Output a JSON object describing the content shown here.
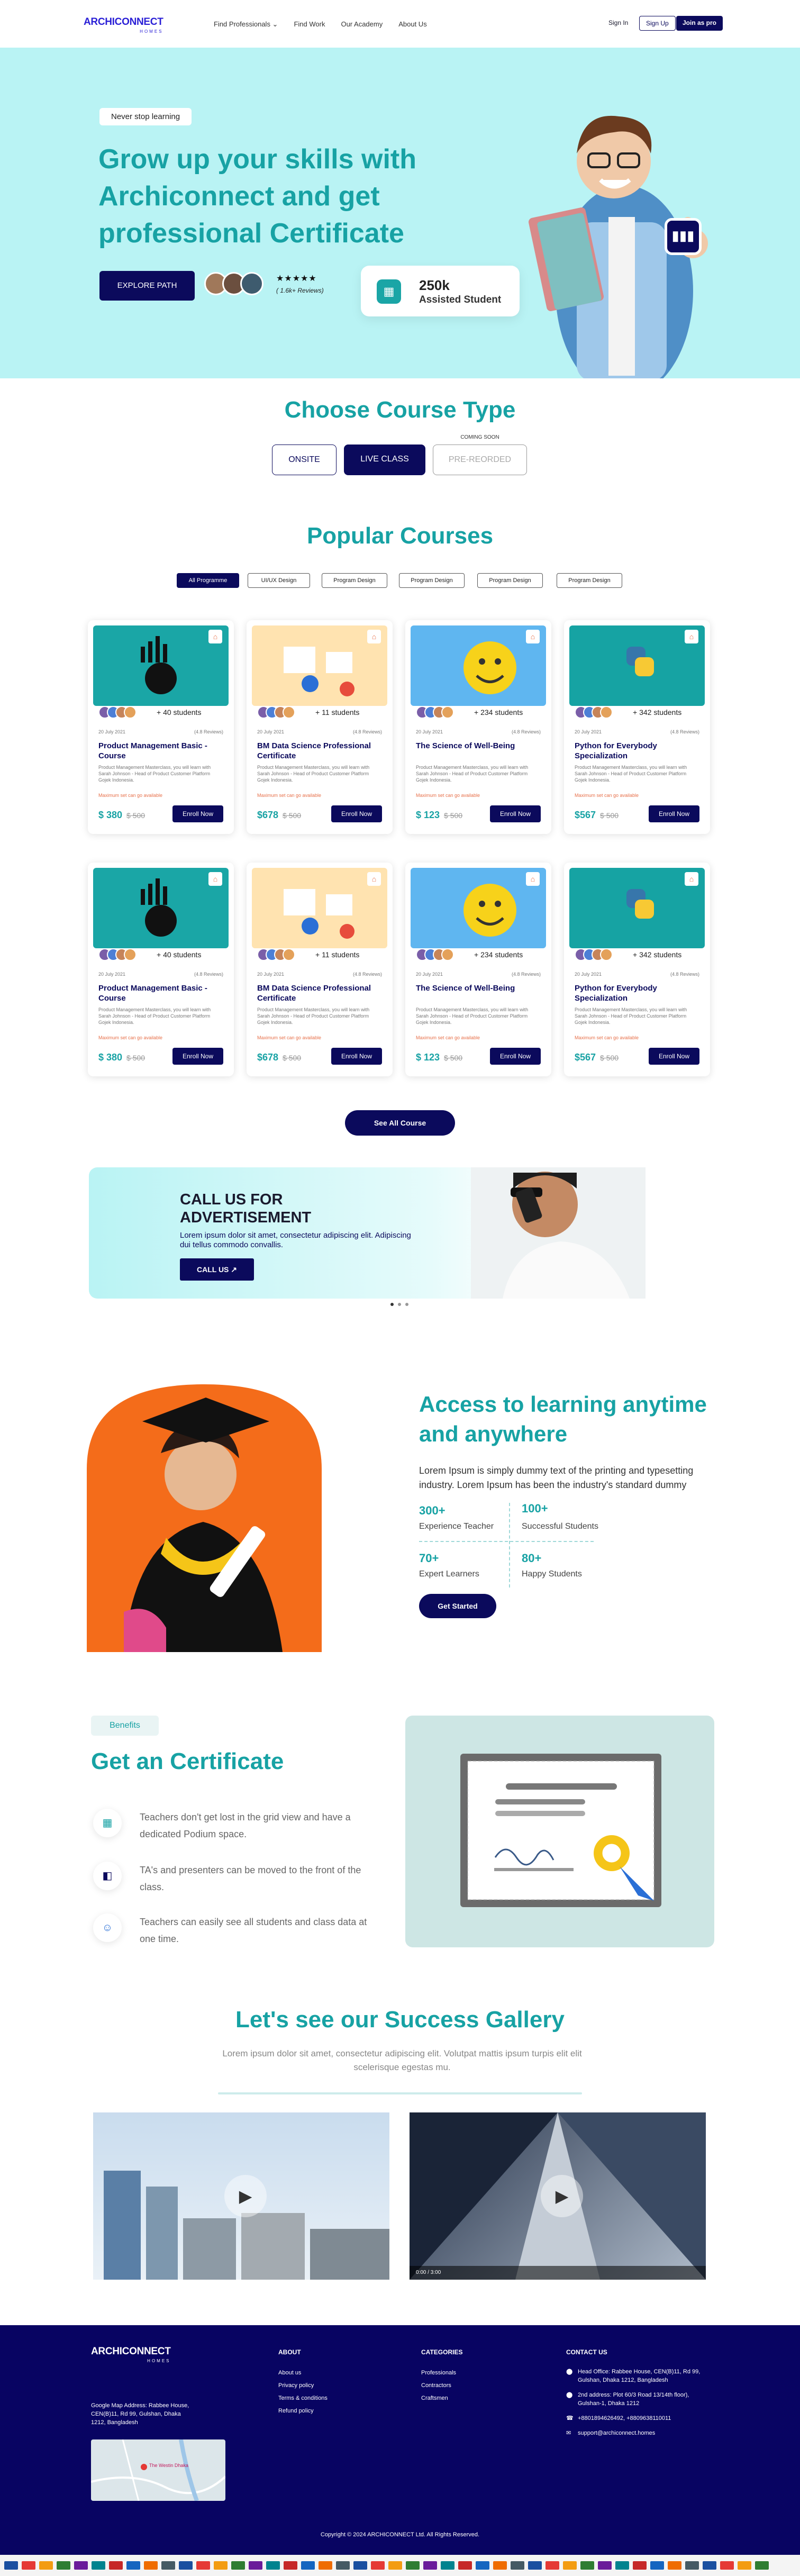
{
  "header": {
    "logo_main": "ARCHICONNECT",
    "logo_sub": "HOMES",
    "nav": [
      "Find Professionals ⌄",
      "Find Work",
      "Our Academy",
      "About Us"
    ],
    "signin": "Sign In",
    "signup": "Sign Up",
    "joinpro": "Join as pro"
  },
  "hero": {
    "pill": "Never stop learning",
    "title": "Grow up your skills with Archiconnect and get professional Certificate",
    "cta": "EXPLORE PATH",
    "stars": "★★★★★",
    "reviews": "( 1.6k+ Reviews)",
    "stat_value": "250k",
    "stat_label": "Assisted Student"
  },
  "course_type": {
    "title": "Choose Course Type",
    "onsite": "ONSITE",
    "live": "LIVE CLASS",
    "coming_soon": "COMING SOON",
    "prerecorded": "PRE-REORDED"
  },
  "popular": {
    "title": "Popular Courses",
    "tabs": [
      "All Programme",
      "UI/UX Design",
      "Program Design",
      "Program Design",
      "Program Design",
      "Program Design"
    ]
  },
  "cards": [
    {
      "students": "+ 40 students",
      "date": "20 July 2021",
      "reviews": "(4.8 Reviews)",
      "title": "Product Management Basic - Course",
      "desc": "Product Management Masterclass, you will learn with Sarah Johnson - Head of Product Customer Platform Gojek Indonesia.",
      "warn": "Maximum set can go available",
      "price": "$ 380",
      "old": "$ 500",
      "enroll": "Enroll Now"
    },
    {
      "students": "+ 11 students",
      "date": "20 July 2021",
      "reviews": "(4.8 Reviews)",
      "title": "BM Data Science Professional Certificate",
      "desc": "Product Management Masterclass, you will learn with Sarah Johnson - Head of Product Customer Platform Gojek Indonesia.",
      "warn": "Maximum set can go available",
      "price": "$678",
      "old": "$ 500",
      "enroll": "Enroll Now"
    },
    {
      "students": "+ 234 students",
      "date": "20 July 2021",
      "reviews": "(4.8 Reviews)",
      "title": "The Science of Well-Being",
      "desc": "Product Management Masterclass, you will learn with Sarah Johnson - Head of Product Customer Platform Gojek Indonesia.",
      "warn": "Maximum set can go available",
      "price": "$ 123",
      "old": "$ 500",
      "enroll": "Enroll Now"
    },
    {
      "students": "+ 342 students",
      "date": "20 July 2021",
      "reviews": "(4.8 Reviews)",
      "title": "Python for Everybody Specialization",
      "desc": "Product Management Masterclass, you will learn with Sarah Johnson - Head of Product Customer Platform Gojek Indonesia.",
      "warn": "Maximum set can go available",
      "price": "$567",
      "old": "$ 500",
      "enroll": "Enroll Now"
    }
  ],
  "see_all": "See All Course",
  "banner": {
    "title": "CALL US FOR ADVERTISEMENT",
    "text": "Lorem ipsum dolor sit amet, consectetur adipiscing elit. Adipiscing dui tellus commodo convallis.",
    "btn": "CALL US ↗"
  },
  "access": {
    "title": "Access to learning anytime and anywhere",
    "text": "Lorem Ipsum is simply dummy text of the printing and typesetting industry. Lorem Ipsum has been the industry's standard dummy",
    "stats": [
      {
        "num": "300+",
        "label": "Experience Teacher"
      },
      {
        "num": "100+",
        "label": "Successful Students"
      },
      {
        "num": "70+",
        "label": "Expert  Learners"
      },
      {
        "num": "80+",
        "label": "Happy Students"
      }
    ],
    "cta": "Get Started"
  },
  "certificate": {
    "badge": "Benefits",
    "title": "Get an Certificate",
    "items": [
      "Teachers don't get lost in the grid view and have a dedicated Podium space.",
      "TA's and presenters can be moved to the front of the class.",
      "Teachers can easily see all students and class data at one time."
    ]
  },
  "gallery": {
    "title": "Let's see our Success Gallery",
    "text": "Lorem ipsum dolor sit amet, consectetur adipiscing elit. Volutpat mattis ipsum turpis elit elit scelerisque egestas mu.",
    "time": "0:00 / 3:00"
  },
  "footer": {
    "logo_main": "ARCHICONNECT",
    "logo_sub": "HOMES",
    "address": "Google Map Address: Rabbee House, CEN(B)11, Rd 99, Gulshan, Dhaka 1212, Bangladesh",
    "about_h": "ABOUT",
    "about": [
      "About us",
      "Privacy policy",
      "Terms & conditions",
      "Refund policy"
    ],
    "cat_h": "CATEGORIES",
    "cats": [
      "Professionals",
      "Contractors",
      "Craftsmen"
    ],
    "contact_h": "CONTACT US",
    "contacts": [
      "Head Office: Rabbee House, CEN(B)11, Rd 99, Gulshan, Dhaka 1212, Bangladesh",
      "2nd address: Plot 60/3 Road 13/14th floor), Gulshan-1, Dhaka 1212",
      "+8801894626492, +8809638110011",
      "support@archiconnect.homes"
    ],
    "map_label": "The Westin Dhaka",
    "copyright": "Copyright © 2024 ARCHICONNECT Ltd. All Rights Reserved."
  },
  "colors": {
    "primary": "#0b0a5c",
    "accent": "#17a2a4",
    "hero_bg": "#b9f3f4"
  }
}
